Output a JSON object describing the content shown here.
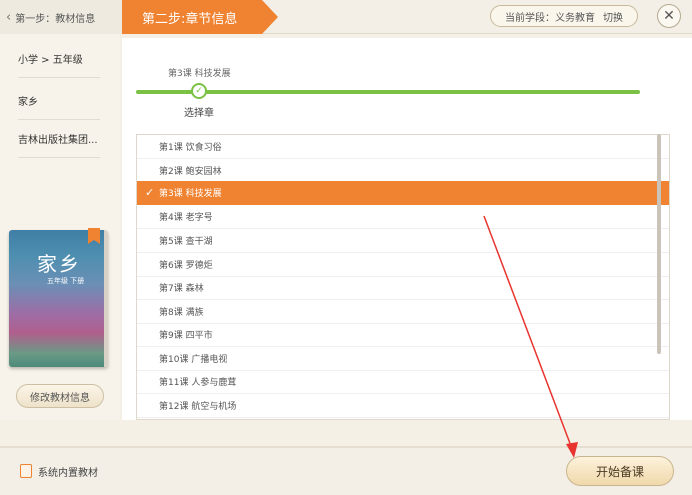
{
  "header": {
    "step1_label": "第一步：教材信息",
    "step2_label": "第二步:章节信息",
    "stage_label": "当前学段：义务教育",
    "switch_label": "切换",
    "close_symbol": "✕"
  },
  "sidebar": {
    "items": [
      {
        "label": "小学 > 五年级"
      },
      {
        "label": "家乡"
      },
      {
        "label": "吉林出版社集团..."
      }
    ],
    "book_title": "家乡",
    "book_subtitle": "五年级 下册",
    "edit_button": "修改教材信息"
  },
  "progress": {
    "current_lesson": "第3课  科技发展",
    "caption": "选择章",
    "check_symbol": "✓"
  },
  "lessons": [
    {
      "label": "第1课  饮食习俗",
      "selected": false
    },
    {
      "label": "第2课  鲍安园林",
      "selected": false
    },
    {
      "label": "第3课  科技发展",
      "selected": true
    },
    {
      "label": "第4课  老字号",
      "selected": false
    },
    {
      "label": "第5课  查干湖",
      "selected": false
    },
    {
      "label": "第6课  罗德炬",
      "selected": false
    },
    {
      "label": "第7课  森林",
      "selected": false
    },
    {
      "label": "第8课  满族",
      "selected": false
    },
    {
      "label": "第9课  四平市",
      "selected": false
    },
    {
      "label": "第10课  广播电视",
      "selected": false
    },
    {
      "label": "第11课  人参与鹿茸",
      "selected": false
    },
    {
      "label": "第12课  航空与机场",
      "selected": false
    }
  ],
  "footer": {
    "system_label": "系统内置教材",
    "start_button": "开始备课"
  },
  "colors": {
    "accent": "#f08331",
    "progress": "#7bc144",
    "annotation_arrow": "#e8342f"
  }
}
